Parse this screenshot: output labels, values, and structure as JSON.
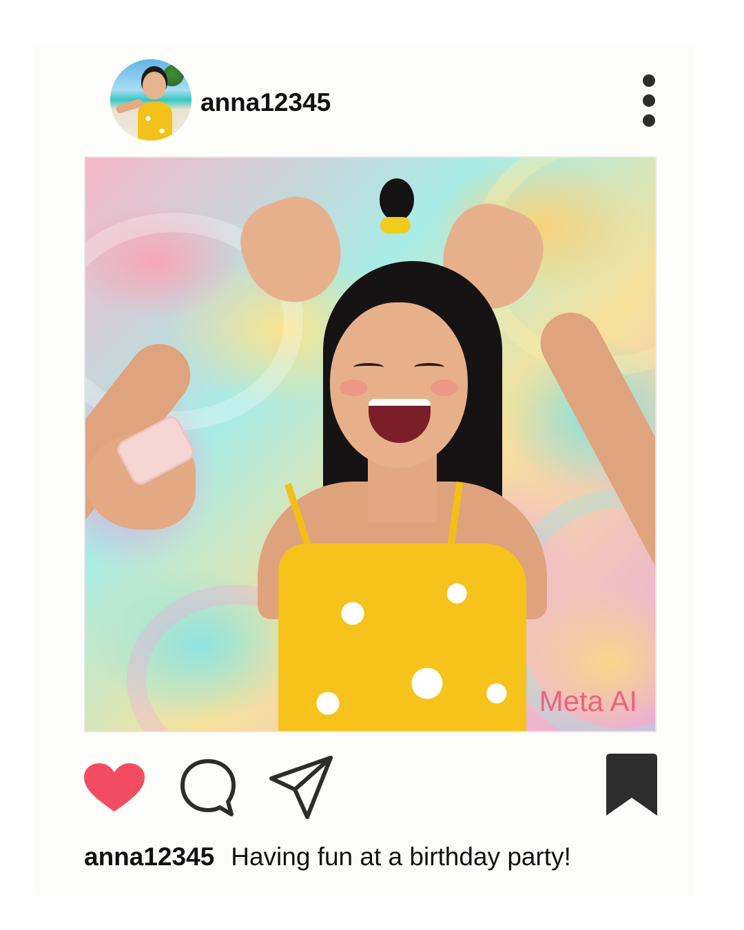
{
  "post": {
    "username": "anna12345",
    "watermark": "Meta AI",
    "caption_username": "anna12345",
    "caption_text": "Having fun at a birthday party!"
  },
  "icons": {
    "more": "more-vertical-icon",
    "like": "heart-icon",
    "comment": "comment-icon",
    "share": "send-icon",
    "save": "bookmark-icon"
  },
  "colors": {
    "like_active": "#f24c63",
    "icon_dark": "#2d2d2d",
    "watermark": "#f0607c",
    "text": "#111111"
  },
  "state": {
    "liked": true,
    "saved": true
  }
}
